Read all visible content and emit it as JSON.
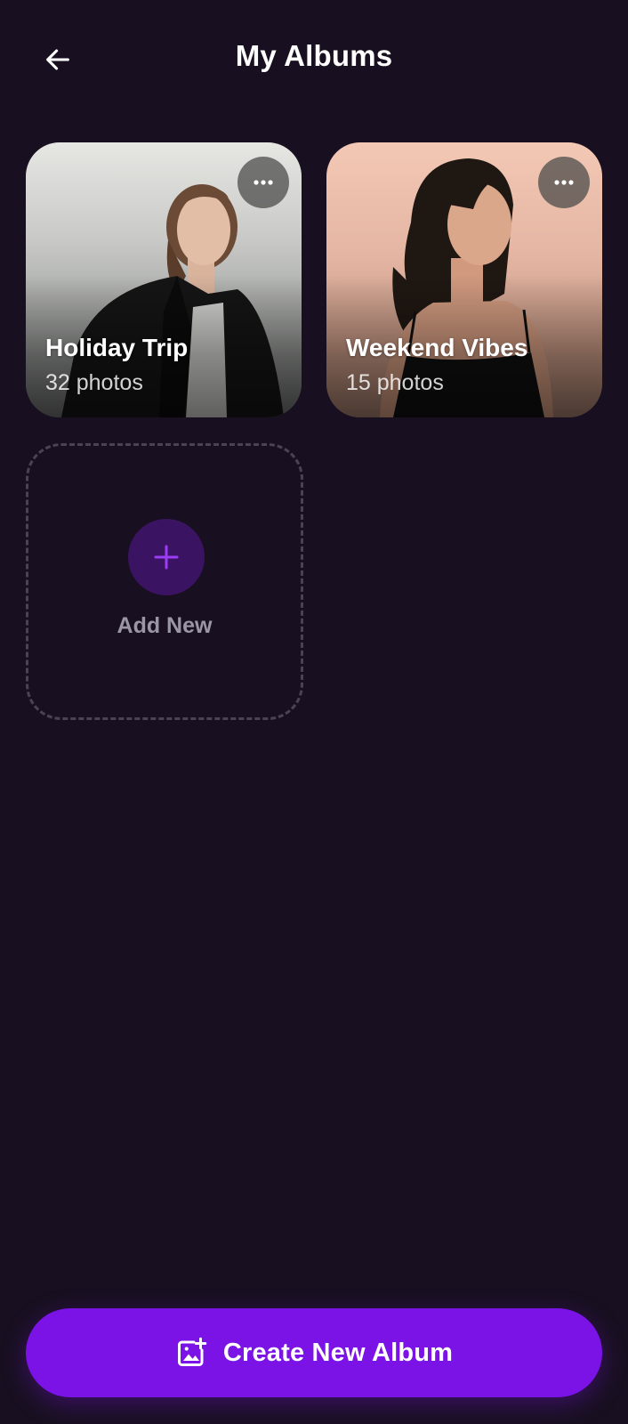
{
  "header": {
    "title": "My Albums",
    "back_icon": "arrow-left-icon"
  },
  "albums": [
    {
      "name": "Holiday Trip",
      "count": "32 photos",
      "menu_icon": "more-horizontal-icon"
    },
    {
      "name": "Weekend Vibes",
      "count": "15 photos",
      "menu_icon": "more-horizontal-icon"
    }
  ],
  "add_new": {
    "label": "Add New",
    "icon": "plus-icon"
  },
  "footer": {
    "create_label": "Create New Album",
    "create_icon": "add-photo-icon"
  },
  "colors": {
    "background": "#181020",
    "accent": "#7b12e6",
    "accent_dark": "#3a1462",
    "muted_text": "#9b96a4"
  }
}
